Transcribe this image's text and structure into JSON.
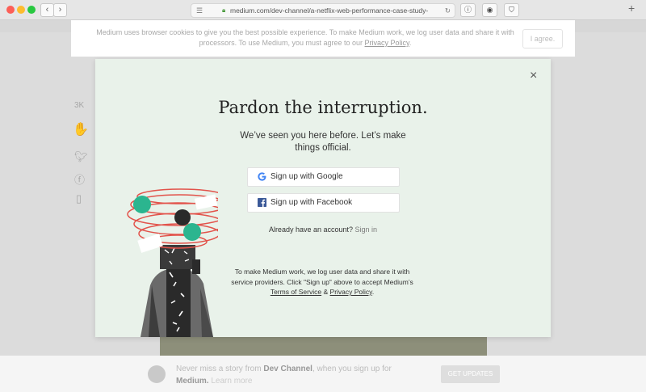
{
  "browser": {
    "url": "medium.com/dev-channel/a-netflix-web-performance-case-study-",
    "back": "‹",
    "forward": "›",
    "reload": "↻",
    "new_tab": "+"
  },
  "cookie_banner": {
    "text": "Medium uses browser cookies to give you the best possible experience. To make Medium work, we log user data and share it with processors. To use Medium, you must agree to our",
    "link": "Privacy Policy",
    "period": ".",
    "agree": "I agree."
  },
  "sidebar": {
    "claps": "3K"
  },
  "modal": {
    "close": "×",
    "title": "Pardon the interruption.",
    "subtitle": "We’ve seen you here before. Let’s make things official.",
    "google_button": "Sign up with Google",
    "facebook_button": "Sign up with Facebook",
    "have_account": "Already have an account?",
    "sign_in": "Sign in",
    "legal_prefix": "To make Medium work, we log user data and share it with service providers. Click \"Sign up\" above to accept Medium’s",
    "terms": "Terms of Service",
    "amp": "&",
    "privacy": "Privacy Policy",
    "legal_end": "."
  },
  "bottom_bar": {
    "text_prefix": "Never miss a story from",
    "channel": "Dev Channel",
    "text_mid": ", when you sign up for",
    "medium": "Medium.",
    "learn_more": "Learn more",
    "button": "GET UPDATES"
  },
  "colors": {
    "modal_bg": "#e9f2ea",
    "accent_green": "#2bb58f",
    "scribble_red": "#e2534b"
  }
}
